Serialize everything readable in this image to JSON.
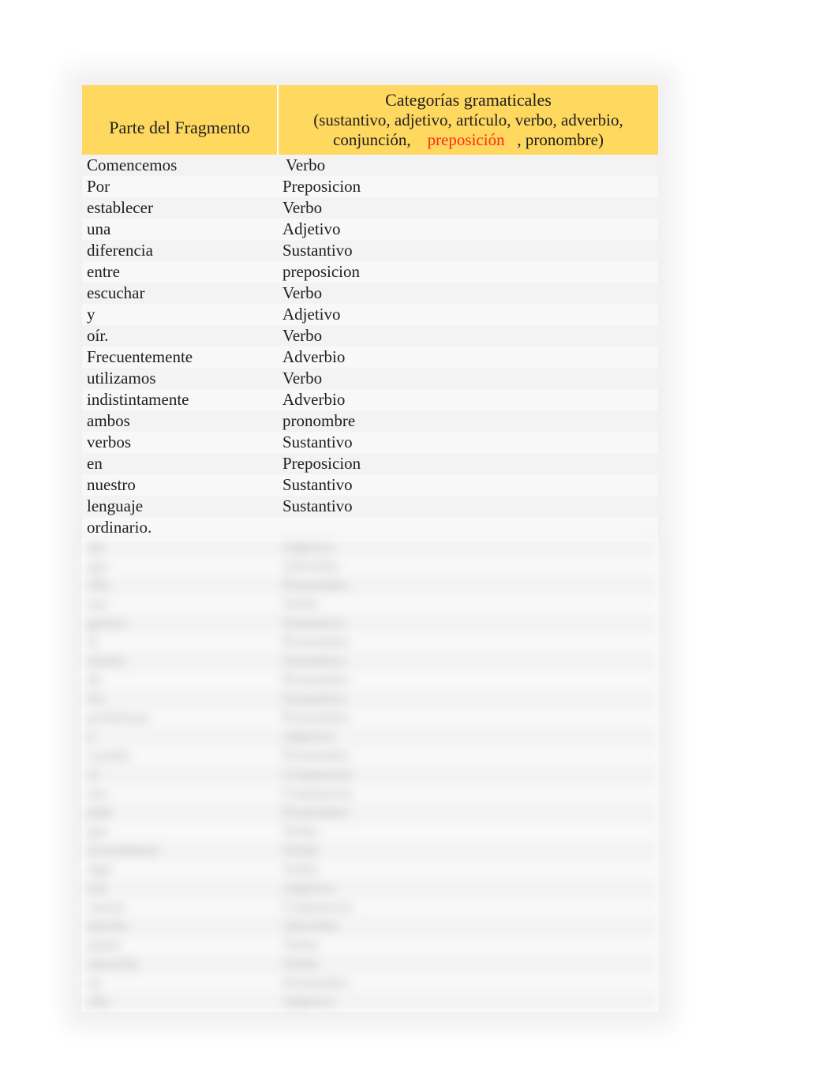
{
  "header": {
    "left": "Parte del Fragmento",
    "right": {
      "title": "Categorías gramaticales",
      "sub_pre": "(sustantivo, adjetivo, artículo, verbo, adverbio,",
      "sub_conj": "conjunción,",
      "sub_red": "preposición",
      "sub_post": ", pronombre)"
    }
  },
  "rows": [
    {
      "frag": "Comencemos",
      "cat": "Verbo",
      "indent": true
    },
    {
      "frag": "Por",
      "cat": "Preposicion"
    },
    {
      "frag": "establecer",
      "cat": "Verbo"
    },
    {
      "frag": "una",
      "cat": "Adjetivo"
    },
    {
      "frag": "diferencia",
      "cat": "Sustantivo"
    },
    {
      "frag": "entre",
      "cat": "preposicion"
    },
    {
      "frag": "escuchar",
      "cat": "Verbo"
    },
    {
      "frag": "y",
      "cat": "Adjetivo"
    },
    {
      "frag": "oír.",
      "cat": "Verbo"
    },
    {
      "frag": "Frecuentemente",
      "cat": "Adverbio"
    },
    {
      "frag": "utilizamos",
      "cat": "Verbo"
    },
    {
      "frag": "indistintamente",
      "cat": "Adverbio"
    },
    {
      "frag": "ambos",
      "cat": "pronombre"
    },
    {
      "frag": "verbos",
      "cat": "Sustantivo"
    },
    {
      "frag": "en",
      "cat": "Preposicion"
    },
    {
      "frag": "nuestro",
      "cat": "Sustantivo"
    },
    {
      "frag": "lenguaje",
      "cat": "Sustantivo"
    },
    {
      "frag": "ordinario.",
      "cat": ""
    }
  ],
  "blurred_rows": [
    {
      "frag": "sin",
      "cat": "Adjetivo"
    },
    {
      "frag": "que",
      "cat": "Adverbio"
    },
    {
      "frag": "ello",
      "cat": "Pronombre"
    },
    {
      "frag": "nos",
      "cat": "Verbo"
    },
    {
      "frag": "genere",
      "cat": "Sustantivo"
    },
    {
      "frag": "el",
      "cat": "Pronombre"
    },
    {
      "frag": "menor",
      "cat": "Sustantivo"
    },
    {
      "frag": "de",
      "cat": "Pronombre"
    },
    {
      "frag": "los",
      "cat": "Sustantivo"
    },
    {
      "frag": "problemas",
      "cat": "Pronombre"
    },
    {
      "frag": "y",
      "cat": "Adjetivo"
    },
    {
      "frag": "cuando",
      "cat": "Pronombre"
    },
    {
      "frag": "se",
      "cat": "Conjuncion"
    },
    {
      "frag": "nos",
      "cat": "Conjuncion"
    },
    {
      "frag": "pide",
      "cat": "Pronombre"
    },
    {
      "frag": "que",
      "cat": "Verbo"
    },
    {
      "frag": "escuchemos",
      "cat": "Verbo"
    },
    {
      "frag": "algo",
      "cat": "Verbo"
    },
    {
      "frag": "nos",
      "cat": "Adjetivo"
    },
    {
      "frag": "cuesta",
      "cat": "Conjuncion"
    },
    {
      "frag": "mucho",
      "cat": "Adverbio"
    },
    {
      "frag": "poner",
      "cat": "Verbo"
    },
    {
      "frag": "atención",
      "cat": "Verbo"
    },
    {
      "frag": "en",
      "cat": "Pronombre"
    },
    {
      "frag": "ello",
      "cat": "Adjetivo"
    }
  ]
}
